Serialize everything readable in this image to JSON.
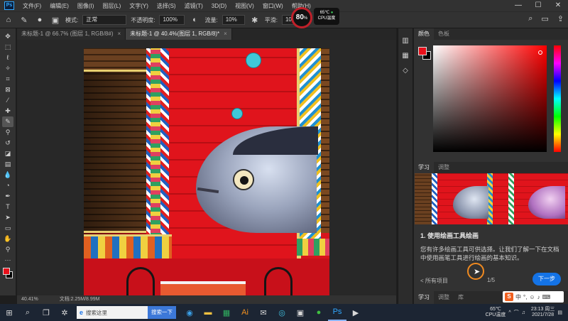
{
  "menubar": {
    "app_icon": "Ps",
    "items": [
      "文件(F)",
      "编辑(E)",
      "图像(I)",
      "图层(L)",
      "文字(Y)",
      "选择(S)",
      "滤镜(T)",
      "3D(D)",
      "视图(V)",
      "窗口(W)",
      "帮助(H)"
    ],
    "window_controls": [
      "—",
      "☐",
      "✕"
    ]
  },
  "options": {
    "mode_label": "模式:",
    "mode_value": "正常",
    "opacity_label": "不透明度:",
    "opacity_value": "100%",
    "flow_label": "流量:",
    "flow_value": "10%",
    "smoothing_label": "平滑:",
    "smoothing_value": "10%"
  },
  "gauge": {
    "value": "80",
    "unit": "%"
  },
  "temp_widget": {
    "temp": "65℃",
    "label": "CPU温度"
  },
  "tabs": [
    {
      "label": "未标题-1 @ 66.7% (图层 1, RGB/8#)",
      "close": "×"
    },
    {
      "label": "未标题-1 @ 40.4%(图层 1, RGB/8)*",
      "close": "×"
    }
  ],
  "status": {
    "zoom": "40.41%",
    "doc": "文档:2.25M/8.99M"
  },
  "color_panel": {
    "tabs": [
      "颜色",
      "色板"
    ]
  },
  "learn_panel": {
    "tabs": [
      "学习",
      "调整"
    ],
    "title": "1. 使用绘画工具绘画",
    "body": "您有许多绘画工具可供选择。让我们了解一下在文档中使用画笔工具进行绘画的基本知识。",
    "prev": "< 所有项目",
    "page": "1/5",
    "next": "下一步"
  },
  "bottom_tabs": [
    "学习",
    "调整",
    "库"
  ],
  "taskbar": {
    "search_placeholder": "搜索这里",
    "search_button": "搜索一下",
    "temp": "65℃",
    "temp_label": "CPU温度",
    "time": "23:13 周三",
    "date": "2021/7/28"
  },
  "ime": {
    "label": "中"
  },
  "colors": {
    "accent": "#1473e6",
    "foreground": "#e8101a",
    "background": "#000000",
    "cursor_ring": "#f08a20"
  }
}
